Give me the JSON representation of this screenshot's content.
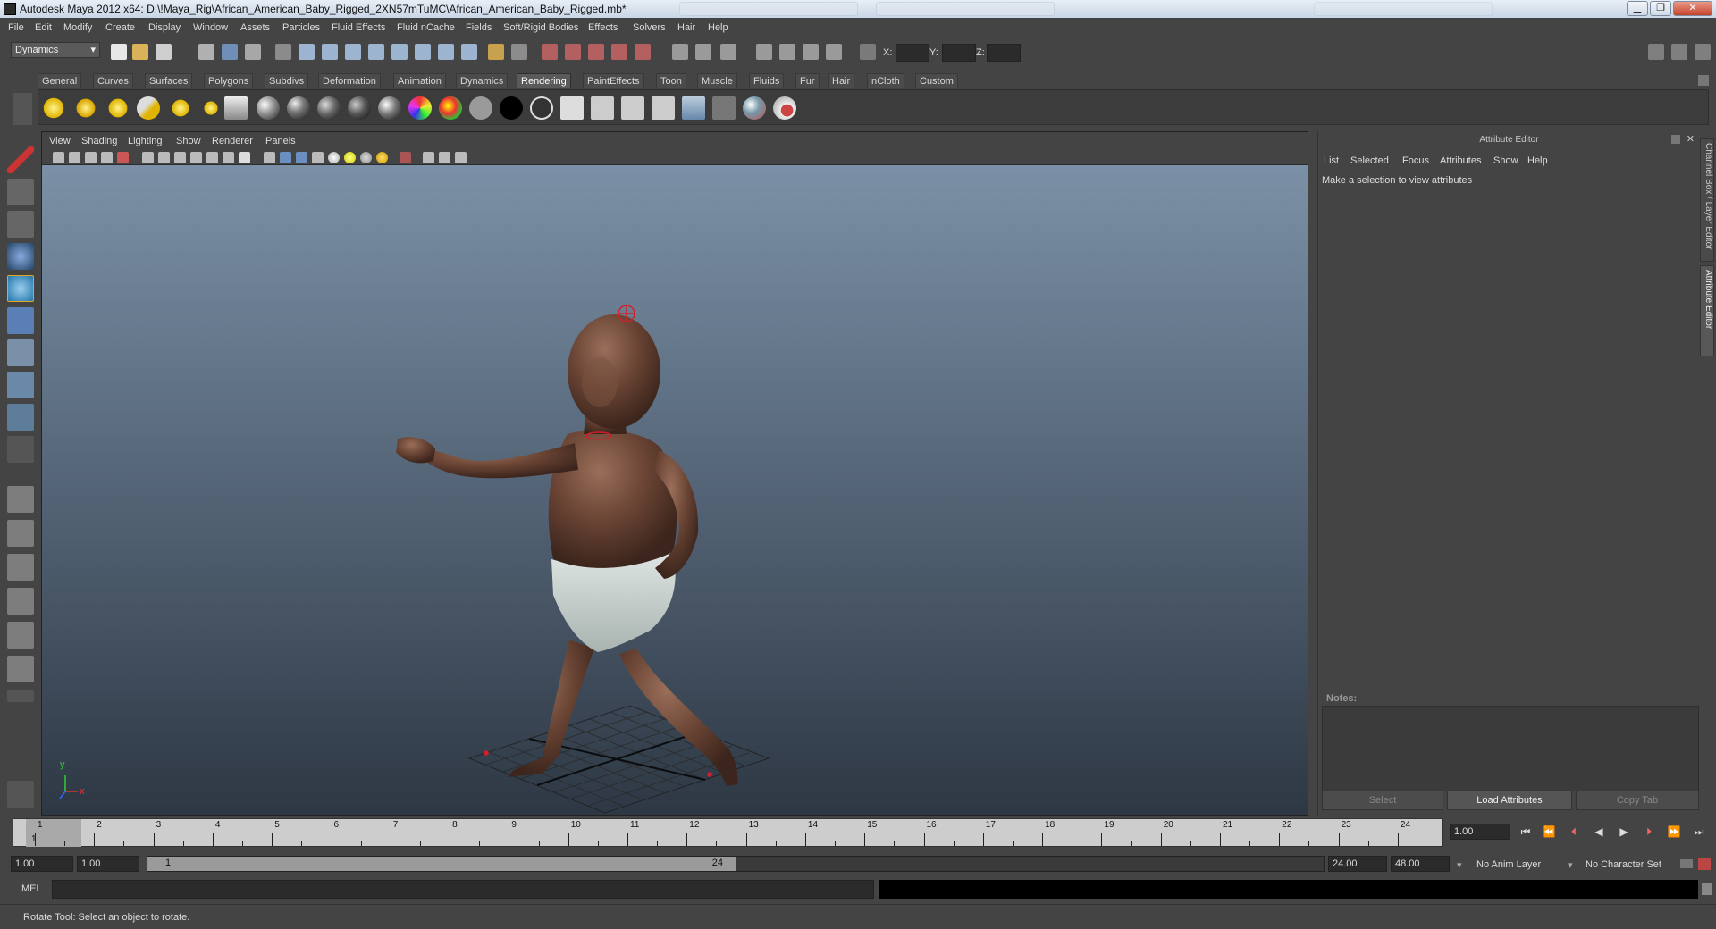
{
  "window": {
    "title": "Autodesk Maya 2012 x64: D:\\!Maya_Rig\\African_American_Baby_Rigged_2XN57mTuMC\\African_American_Baby_Rigged.mb*",
    "controls": [
      "minimize-icon",
      "maximize-icon",
      "close-icon"
    ]
  },
  "menubar": [
    "File",
    "Edit",
    "Modify",
    "Create",
    "Display",
    "Window",
    "Assets",
    "Particles",
    "Fluid Effects",
    "Fluid nCache",
    "Fields",
    "Soft/Rigid Bodies",
    "Effects",
    "Solvers",
    "Hair",
    "Help"
  ],
  "statusline": {
    "mode": "Dynamics",
    "x_label": "X:",
    "y_label": "Y:",
    "z_label": "Z:"
  },
  "shelf": {
    "tabs": [
      "General",
      "Curves",
      "Surfaces",
      "Polygons",
      "Subdivs",
      "Deformation",
      "Animation",
      "Dynamics",
      "Rendering",
      "PaintEffects",
      "Toon",
      "Muscle",
      "Fluids",
      "Fur",
      "Hair",
      "nCloth",
      "Custom"
    ],
    "active_tab": "Rendering"
  },
  "viewport": {
    "menu": [
      "View",
      "Shading",
      "Lighting",
      "Show",
      "Renderer",
      "Panels"
    ],
    "axis_y": "y",
    "axis_x": "x"
  },
  "attribute_editor": {
    "title": "Attribute Editor",
    "menu": [
      "List",
      "Selected",
      "Focus",
      "Attributes",
      "Show",
      "Help"
    ],
    "message": "Make a selection to view attributes",
    "notes_label": "Notes:",
    "buttons": [
      "Select",
      "Load Attributes",
      "Copy Tab"
    ],
    "side_tabs": [
      "Channel Box / Layer Editor",
      "Attribute Editor"
    ]
  },
  "timeline": {
    "labels": [
      "1",
      "2",
      "3",
      "4",
      "5",
      "6",
      "7",
      "8",
      "9",
      "10",
      "11",
      "12",
      "13",
      "14",
      "15",
      "16",
      "17",
      "18",
      "19",
      "20",
      "21",
      "22",
      "23",
      "24"
    ],
    "current_frame_label": "1",
    "current_time": "1.00"
  },
  "range": {
    "start": "1.00",
    "playback_start": "1.00",
    "handle_start": "1",
    "handle_end": "24",
    "playback_end": "24.00",
    "end": "48.00",
    "anim_layer": "No Anim Layer",
    "character_set": "No Character Set"
  },
  "command_line": {
    "language": "MEL"
  },
  "help_line": "Rotate Tool: Select an object to rotate.",
  "colors": {
    "accent": "#e0a820",
    "panel": "#444444",
    "viewport_top": "#7f95ab",
    "viewport_bottom": "#2e3844"
  }
}
